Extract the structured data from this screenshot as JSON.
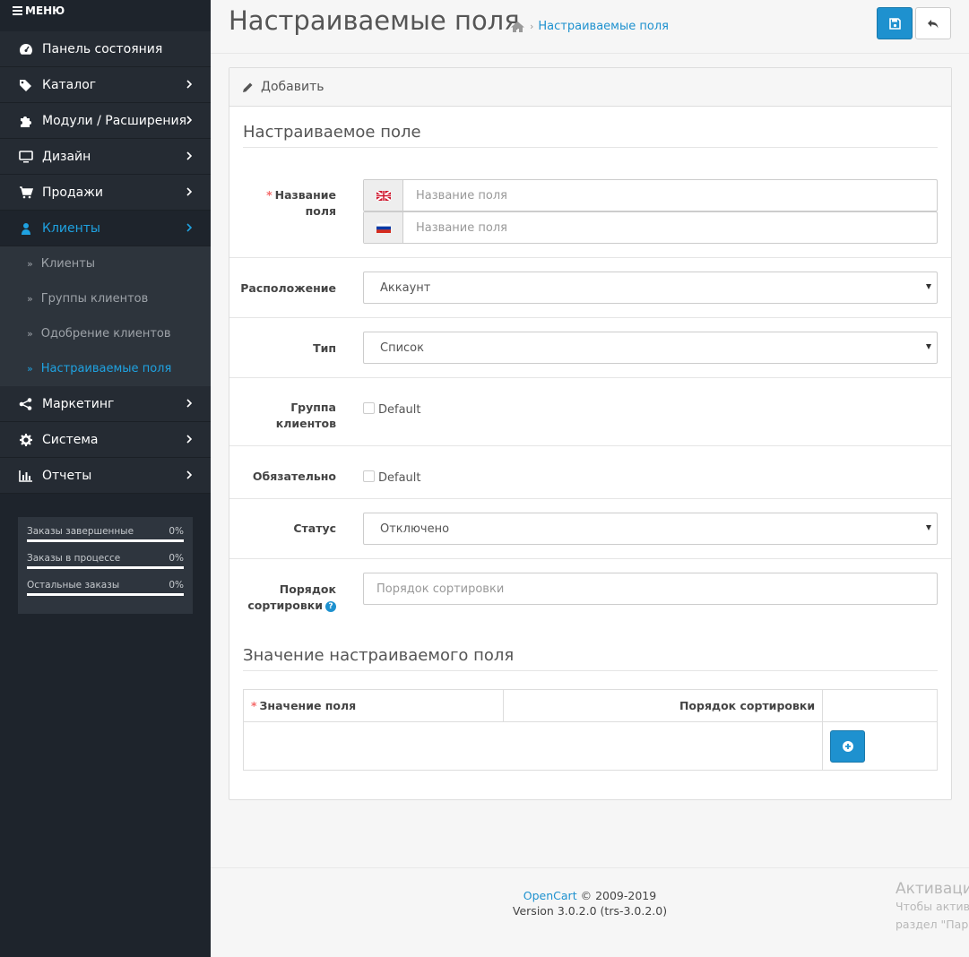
{
  "sidebar": {
    "menu_label": "МЕНЮ",
    "items": [
      {
        "label": "Панель состояния",
        "icon": "dashboard-icon"
      },
      {
        "label": "Каталог",
        "icon": "tags-icon"
      },
      {
        "label": "Модули / Расширения",
        "icon": "puzzle-icon"
      },
      {
        "label": "Дизайн",
        "icon": "monitor-icon"
      },
      {
        "label": "Продажи",
        "icon": "cart-icon"
      },
      {
        "label": "Клиенты",
        "icon": "user-icon"
      },
      {
        "label": "Маркетинг",
        "icon": "share-icon"
      },
      {
        "label": "Система",
        "icon": "gear-icon"
      },
      {
        "label": "Отчеты",
        "icon": "bar-chart-icon"
      }
    ],
    "sub_items": [
      {
        "label": "Клиенты"
      },
      {
        "label": "Группы клиентов"
      },
      {
        "label": "Одобрение клиентов"
      },
      {
        "label": "Настраиваемые поля"
      }
    ],
    "stats": [
      {
        "label": "Заказы завершенные",
        "value": "0%"
      },
      {
        "label": "Заказы в процессе",
        "value": "0%"
      },
      {
        "label": "Остальные заказы",
        "value": "0%"
      }
    ]
  },
  "header": {
    "title": "Настраиваемые поля",
    "breadcrumb": "Настраиваемые поля"
  },
  "panel": {
    "heading": "Добавить",
    "legend1": "Настраиваемое поле",
    "legend2": "Значение настраиваемого поля"
  },
  "form": {
    "name_label": "Название поля",
    "name_placeholder": "Название поля",
    "location_label": "Расположение",
    "location_value": "Аккаунт",
    "type_label": "Тип",
    "type_value": "Список",
    "group_label": "Группа клиентов",
    "group_option": "Default",
    "required_label": "Обязательно",
    "required_option": "Default",
    "status_label": "Статус",
    "status_value": "Отключено",
    "sort_label": "Порядок сортировки",
    "sort_placeholder": "Порядок сортировки"
  },
  "table": {
    "col1": "Значение поля",
    "col2": "Порядок сортировки"
  },
  "footer": {
    "brand": "OpenCart",
    "copyright": "© 2009-2019",
    "version": "Version 3.0.2.0 (trs-3.0.2.0)"
  },
  "watermark": {
    "line1": "Активаци",
    "line2": "Чтобы актив",
    "line3": "раздел \"Пар"
  },
  "colors": {
    "accent": "#1e91cf",
    "sidebar_bg": "#1e242c",
    "required": "#f56b6b"
  }
}
